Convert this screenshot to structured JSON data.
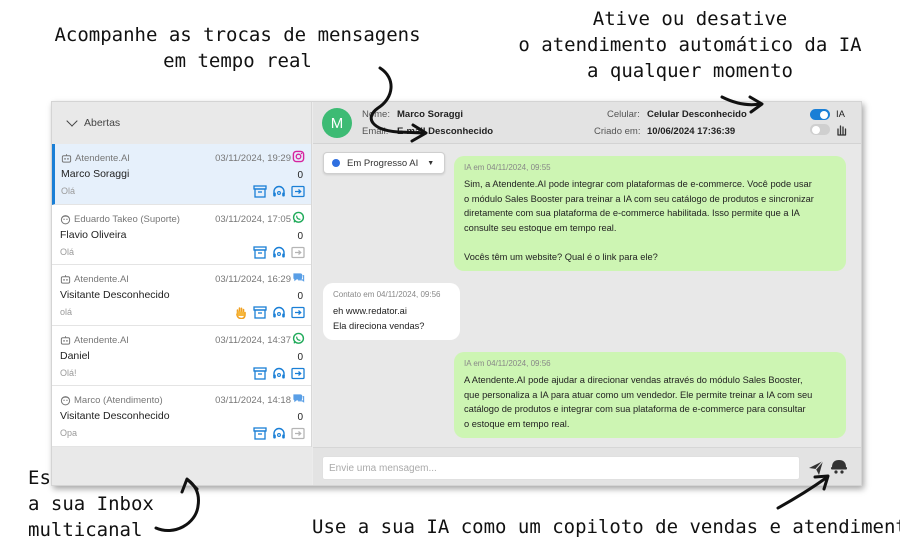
{
  "annotations": {
    "realtime": [
      "Acompanhe as trocas de mensagens",
      "em tempo real"
    ],
    "toggle_ai": [
      "Ative ou desative",
      "o atendimento automático da IA",
      "a qualquer momento"
    ],
    "inbox": [
      "Essa é",
      "a sua Inbox",
      "multicanal"
    ],
    "copilot": "Use a sua IA como um copiloto de vendas e atendimento"
  },
  "sidebar": {
    "filter_label": "Abertas",
    "conversations": [
      {
        "agent": "Atendente.AI",
        "agent_icon": "bot-icon",
        "time": "03/11/2024, 19:29",
        "channel": "instagram",
        "name": "Marco Soraggi",
        "count": "0",
        "preview": "Olá",
        "hand": false,
        "active": true,
        "forward_enabled": true
      },
      {
        "agent": "Eduardo Takeo (Suporte)",
        "agent_icon": "user-face-icon",
        "time": "03/11/2024, 17:05",
        "channel": "whatsapp",
        "name": "Flavio Oliveira",
        "count": "0",
        "preview": "Olá",
        "hand": false,
        "active": false,
        "forward_enabled": false
      },
      {
        "agent": "Atendente.AI",
        "agent_icon": "bot-icon",
        "time": "03/11/2024, 16:29",
        "channel": "chat",
        "name": "Visitante Desconhecido",
        "count": "0",
        "preview": "olá",
        "hand": true,
        "active": false,
        "forward_enabled": true
      },
      {
        "agent": "Atendente.AI",
        "agent_icon": "bot-icon",
        "time": "03/11/2024, 14:37",
        "channel": "whatsapp",
        "name": "Daniel",
        "count": "0",
        "preview": "Olá!",
        "hand": false,
        "active": false,
        "forward_enabled": true
      },
      {
        "agent": "Marco (Atendimento)",
        "agent_icon": "user-face-icon",
        "time": "03/11/2024, 14:18",
        "channel": "chat",
        "name": "Visitante Desconhecido",
        "count": "0",
        "preview": "Opa",
        "hand": false,
        "active": false,
        "forward_enabled": false
      }
    ]
  },
  "contact": {
    "avatar_letter": "M",
    "name_label": "Nome:",
    "name": "Marco Soraggi",
    "email_label": "Email:",
    "email": "E-mail Desconhecido",
    "phone_label": "Celular:",
    "phone": "Celular Desconhecido",
    "created_label": "Criado em:",
    "created": "10/06/2024 17:36:39",
    "ai_label": "IA",
    "ai_enabled": true
  },
  "chat": {
    "status": "Em Progresso AI",
    "messages": [
      {
        "from": "ia",
        "meta": "IA em 04/11/2024, 09:55",
        "lines": [
          "Sim, a Atendente.AI pode integrar com plataformas de e-commerce. Você pode usar",
          "o módulo Sales Booster para treinar a IA com seu catálogo de produtos e sincronizar",
          "diretamente com sua plataforma de e-commerce habilitada. Isso permite que a IA",
          "consulte seu estoque em tempo real.",
          "",
          "Vocês têm um website? Qual é o link para ele?"
        ]
      },
      {
        "from": "user",
        "meta": "Contato em 04/11/2024, 09:56",
        "lines": [
          "eh www.redator.ai",
          "Ela direciona vendas?"
        ]
      },
      {
        "from": "ia",
        "meta": "IA em 04/11/2024, 09:56",
        "lines": [
          "A Atendente.AI pode ajudar a direcionar vendas através do módulo Sales Booster,",
          "que personaliza a IA para atuar como um vendedor. Ele permite treinar a IA com seu",
          "catálogo de produtos e integrar com sua plataforma de e-commerce para consultar",
          "o estoque em tempo real."
        ]
      }
    ],
    "composer_placeholder": "Envie uma mensagem..."
  },
  "colors": {
    "accent": "#1a7fd6",
    "ia_bubble": "#cdf5b3",
    "avatar": "#3dbb74",
    "instagram": "#d6249f",
    "whatsapp": "#1faa59",
    "chat_icon": "#5a9fe6"
  }
}
